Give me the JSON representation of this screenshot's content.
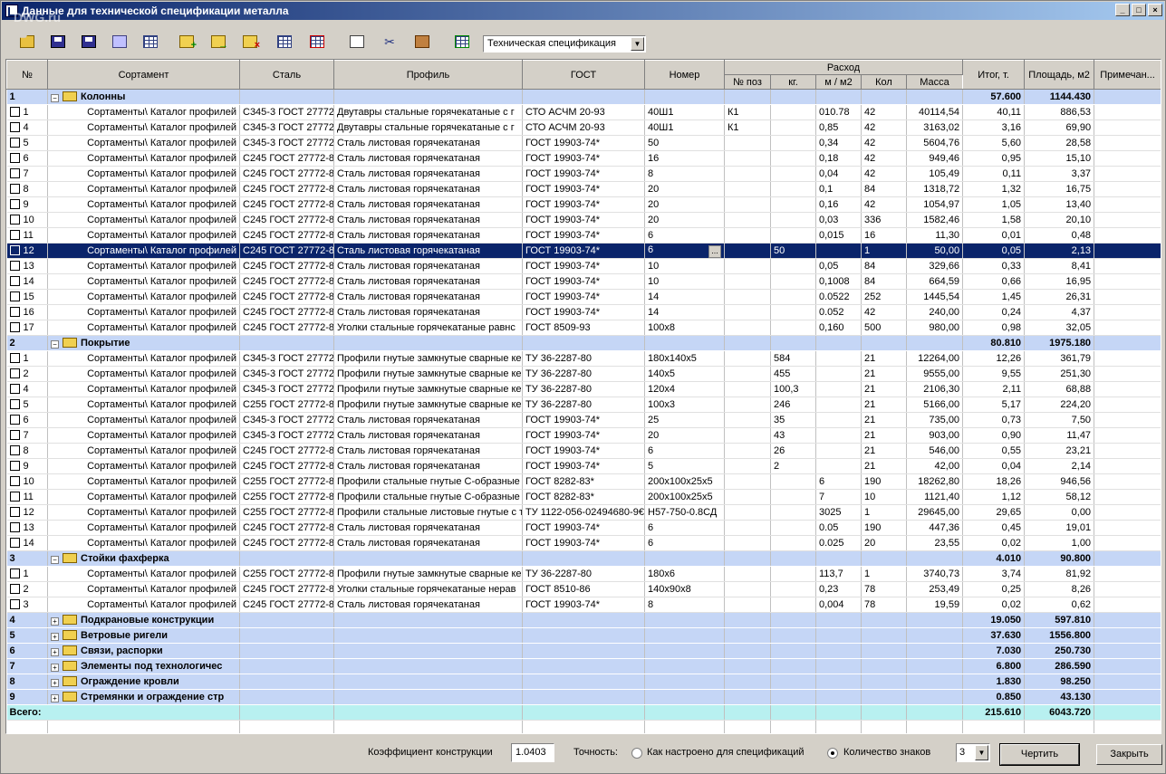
{
  "window": {
    "title": "Данные для технической спецификации металла",
    "watermark": "DWG.ru",
    "min_glyph": "_",
    "max_glyph": "□",
    "close_glyph": "×"
  },
  "toolbar": {
    "icons": [
      "open-icon",
      "save-icon",
      "save-as-icon",
      "properties-icon",
      "table-edit-icon",
      "add-folder-icon",
      "add-subfolder-icon",
      "delete-folder-icon",
      "add-row-icon",
      "delete-row-icon",
      "copy-icon",
      "cut-icon",
      "paste-icon",
      "settings-icon"
    ],
    "spec_type": "Техническая спецификация"
  },
  "columns": {
    "num": "№",
    "sortament": "Сортамент",
    "steel": "Сталь",
    "profile": "Профиль",
    "gost": "ГОСТ",
    "nomer": "Номер",
    "rashod": "Расход",
    "poz": "№ поз",
    "kg": "кг.",
    "m": "м / м2",
    "kol": "Кол",
    "massa": "Масса",
    "itog": "Итог, т.",
    "area": "Площадь, м2",
    "note": "Примечан..."
  },
  "groups": [
    {
      "num": "1",
      "name": "Колонны",
      "itog": "57.600",
      "area": "1144.430",
      "expanded": true,
      "rows": [
        {
          "n": "1",
          "s": "Сортаменты\\ Каталог профилей",
          "st": "С345-3 ГОСТ 27772",
          "p": "Двутавры стальные горячекатаные с г",
          "g": "СТО АСЧМ 20-93",
          "nm": "40Ш1",
          "poz": "К1",
          "kg": "",
          "m": "010.78",
          "kol": "42",
          "ms": "40114,54",
          "it": "40,11",
          "ar": "886,53"
        },
        {
          "n": "4",
          "s": "Сортаменты\\ Каталог профилей",
          "st": "С345-3 ГОСТ 27772",
          "p": "Двутавры стальные горячекатаные с г",
          "g": "СТО АСЧМ 20-93",
          "nm": "40Ш1",
          "poz": "К1",
          "kg": "",
          "m": "0,85",
          "kol": "42",
          "ms": "3163,02",
          "it": "3,16",
          "ar": "69,90"
        },
        {
          "n": "5",
          "s": "Сортаменты\\ Каталог профилей",
          "st": "С345-3 ГОСТ 27772",
          "p": "Сталь листовая горячекатаная",
          "g": "ГОСТ 19903-74*",
          "nm": "50",
          "poz": "",
          "kg": "",
          "m": "0,34",
          "kol": "42",
          "ms": "5604,76",
          "it": "5,60",
          "ar": "28,58"
        },
        {
          "n": "6",
          "s": "Сортаменты\\ Каталог профилей",
          "st": "С245 ГОСТ 27772-8",
          "p": "Сталь листовая горячекатаная",
          "g": "ГОСТ 19903-74*",
          "nm": "16",
          "poz": "",
          "kg": "",
          "m": "0,18",
          "kol": "42",
          "ms": "949,46",
          "it": "0,95",
          "ar": "15,10"
        },
        {
          "n": "7",
          "s": "Сортаменты\\ Каталог профилей",
          "st": "С245 ГОСТ 27772-8",
          "p": "Сталь листовая горячекатаная",
          "g": "ГОСТ 19903-74*",
          "nm": "8",
          "poz": "",
          "kg": "",
          "m": "0,04",
          "kol": "42",
          "ms": "105,49",
          "it": "0,11",
          "ar": "3,37"
        },
        {
          "n": "8",
          "s": "Сортаменты\\ Каталог профилей",
          "st": "С245 ГОСТ 27772-8",
          "p": "Сталь листовая горячекатаная",
          "g": "ГОСТ 19903-74*",
          "nm": "20",
          "poz": "",
          "kg": "",
          "m": "0,1",
          "kol": "84",
          "ms": "1318,72",
          "it": "1,32",
          "ar": "16,75"
        },
        {
          "n": "9",
          "s": "Сортаменты\\ Каталог профилей",
          "st": "С245 ГОСТ 27772-8",
          "p": "Сталь листовая горячекатаная",
          "g": "ГОСТ 19903-74*",
          "nm": "20",
          "poz": "",
          "kg": "",
          "m": "0,16",
          "kol": "42",
          "ms": "1054,97",
          "it": "1,05",
          "ar": "13,40"
        },
        {
          "n": "10",
          "s": "Сортаменты\\ Каталог профилей",
          "st": "С245 ГОСТ 27772-8",
          "p": "Сталь листовая горячекатаная",
          "g": "ГОСТ 19903-74*",
          "nm": "20",
          "poz": "",
          "kg": "",
          "m": "0,03",
          "kol": "336",
          "ms": "1582,46",
          "it": "1,58",
          "ar": "20,10"
        },
        {
          "n": "11",
          "s": "Сортаменты\\ Каталог профилей",
          "st": "С245 ГОСТ 27772-8",
          "p": "Сталь листовая горячекатаная",
          "g": "ГОСТ 19903-74*",
          "nm": "6",
          "poz": "",
          "kg": "",
          "m": "0,015",
          "kol": "16",
          "ms": "11,30",
          "it": "0,01",
          "ar": "0,48"
        },
        {
          "n": "12",
          "s": "Сортаменты\\ Каталог профилей",
          "st": "С245 ГОСТ 27772-8",
          "p": "Сталь листовая горячекатаная",
          "g": "ГОСТ 19903-74*",
          "nm": "6",
          "poz": "",
          "kg": "50",
          "m": "",
          "kol": "1",
          "ms": "50,00",
          "it": "0,05",
          "ar": "2,13",
          "selected": true
        },
        {
          "n": "13",
          "s": "Сортаменты\\ Каталог профилей",
          "st": "С245 ГОСТ 27772-8",
          "p": "Сталь листовая горячекатаная",
          "g": "ГОСТ 19903-74*",
          "nm": "10",
          "poz": "",
          "kg": "",
          "m": "0,05",
          "kol": "84",
          "ms": "329,66",
          "it": "0,33",
          "ar": "8,41"
        },
        {
          "n": "14",
          "s": "Сортаменты\\ Каталог профилей",
          "st": "С245 ГОСТ 27772-8",
          "p": "Сталь листовая горячекатаная",
          "g": "ГОСТ 19903-74*",
          "nm": "10",
          "poz": "",
          "kg": "",
          "m": "0,1008",
          "kol": "84",
          "ms": "664,59",
          "it": "0,66",
          "ar": "16,95"
        },
        {
          "n": "15",
          "s": "Сортаменты\\ Каталог профилей",
          "st": "С245 ГОСТ 27772-8",
          "p": "Сталь листовая горячекатаная",
          "g": "ГОСТ 19903-74*",
          "nm": "14",
          "poz": "",
          "kg": "",
          "m": "0.0522",
          "kol": "252",
          "ms": "1445,54",
          "it": "1,45",
          "ar": "26,31"
        },
        {
          "n": "16",
          "s": "Сортаменты\\ Каталог профилей",
          "st": "С245 ГОСТ 27772-8",
          "p": "Сталь листовая горячекатаная",
          "g": "ГОСТ 19903-74*",
          "nm": "14",
          "poz": "",
          "kg": "",
          "m": "0.052",
          "kol": "42",
          "ms": "240,00",
          "it": "0,24",
          "ar": "4,37"
        },
        {
          "n": "17",
          "s": "Сортаменты\\ Каталог профилей",
          "st": "С245 ГОСТ 27772-8",
          "p": "Уголки стальные горячекатаные равнс",
          "g": "ГОСТ 8509-93",
          "nm": "100x8",
          "poz": "",
          "kg": "",
          "m": "0,160",
          "kol": "500",
          "ms": "980,00",
          "it": "0,98",
          "ar": "32,05"
        }
      ]
    },
    {
      "num": "2",
      "name": "Покрытие",
      "itog": "80.810",
      "area": "1975.180",
      "expanded": true,
      "rows": [
        {
          "n": "1",
          "s": "Сортаменты\\ Каталог профилей",
          "st": "С345-3 ГОСТ 27772",
          "p": "Профили гнутые замкнутые сварные ке",
          "g": "ТУ 36-2287-80",
          "nm": "180x140x5",
          "poz": "",
          "kg": "584",
          "m": "",
          "kol": "21",
          "ms": "12264,00",
          "it": "12,26",
          "ar": "361,79"
        },
        {
          "n": "2",
          "s": "Сортаменты\\ Каталог профилей",
          "st": "С345-3 ГОСТ 27772",
          "p": "Профили гнутые замкнутые сварные ке",
          "g": "ТУ 36-2287-80",
          "nm": "140x5",
          "poz": "",
          "kg": "455",
          "m": "",
          "kol": "21",
          "ms": "9555,00",
          "it": "9,55",
          "ar": "251,30"
        },
        {
          "n": "4",
          "s": "Сортаменты\\ Каталог профилей",
          "st": "С345-3 ГОСТ 27772",
          "p": "Профили гнутые замкнутые сварные ке",
          "g": "ТУ 36-2287-80",
          "nm": "120x4",
          "poz": "",
          "kg": "100,3",
          "m": "",
          "kol": "21",
          "ms": "2106,30",
          "it": "2,11",
          "ar": "68,88"
        },
        {
          "n": "5",
          "s": "Сортаменты\\ Каталог профилей",
          "st": "С255 ГОСТ 27772-8",
          "p": "Профили гнутые замкнутые сварные ке",
          "g": "ТУ 36-2287-80",
          "nm": "100x3",
          "poz": "",
          "kg": "246",
          "m": "",
          "kol": "21",
          "ms": "5166,00",
          "it": "5,17",
          "ar": "224,20"
        },
        {
          "n": "6",
          "s": "Сортаменты\\ Каталог профилей",
          "st": "С345-3 ГОСТ 27772",
          "p": "Сталь листовая горячекатаная",
          "g": "ГОСТ 19903-74*",
          "nm": "25",
          "poz": "",
          "kg": "35",
          "m": "",
          "kol": "21",
          "ms": "735,00",
          "it": "0,73",
          "ar": "7,50"
        },
        {
          "n": "7",
          "s": "Сортаменты\\ Каталог профилей",
          "st": "С345-3 ГОСТ 27772",
          "p": "Сталь листовая горячекатаная",
          "g": "ГОСТ 19903-74*",
          "nm": "20",
          "poz": "",
          "kg": "43",
          "m": "",
          "kol": "21",
          "ms": "903,00",
          "it": "0,90",
          "ar": "11,47"
        },
        {
          "n": "8",
          "s": "Сортаменты\\ Каталог профилей",
          "st": "С245 ГОСТ 27772-8",
          "p": "Сталь листовая горячекатаная",
          "g": "ГОСТ 19903-74*",
          "nm": "6",
          "poz": "",
          "kg": "26",
          "m": "",
          "kol": "21",
          "ms": "546,00",
          "it": "0,55",
          "ar": "23,21"
        },
        {
          "n": "9",
          "s": "Сортаменты\\ Каталог профилей",
          "st": "С245 ГОСТ 27772-8",
          "p": "Сталь листовая горячекатаная",
          "g": "ГОСТ 19903-74*",
          "nm": "5",
          "poz": "",
          "kg": "2",
          "m": "",
          "kol": "21",
          "ms": "42,00",
          "it": "0,04",
          "ar": "2,14"
        },
        {
          "n": "10",
          "s": "Сортаменты\\ Каталог профилей",
          "st": "С255 ГОСТ 27772-8",
          "p": "Профили стальные гнутые С-образные",
          "g": "ГОСТ 8282-83*",
          "nm": "200x100x25x5",
          "poz": "",
          "kg": "",
          "m": "6",
          "kol": "190",
          "ms": "18262,80",
          "it": "18,26",
          "ar": "946,56"
        },
        {
          "n": "11",
          "s": "Сортаменты\\ Каталог профилей",
          "st": "С255 ГОСТ 27772-8",
          "p": "Профили стальные гнутые С-образные",
          "g": "ГОСТ 8282-83*",
          "nm": "200x100x25x5",
          "poz": "",
          "kg": "",
          "m": "7",
          "kol": "10",
          "ms": "1121,40",
          "it": "1,12",
          "ar": "58,12"
        },
        {
          "n": "12",
          "s": "Сортаменты\\ Каталог профилей",
          "st": "С255 ГОСТ 27772-8",
          "p": "Профили стальные листовые гнутые с т",
          "g": "ТУ 1122-056-02494680-9€",
          "nm": "Н57-750-0.8СД",
          "poz": "",
          "kg": "",
          "m": "3025",
          "kol": "1",
          "ms": "29645,00",
          "it": "29,65",
          "ar": "0,00"
        },
        {
          "n": "13",
          "s": "Сортаменты\\ Каталог профилей",
          "st": "С245 ГОСТ 27772-8",
          "p": "Сталь листовая горячекатаная",
          "g": "ГОСТ 19903-74*",
          "nm": "6",
          "poz": "",
          "kg": "",
          "m": "0.05",
          "kol": "190",
          "ms": "447,36",
          "it": "0,45",
          "ar": "19,01"
        },
        {
          "n": "14",
          "s": "Сортаменты\\ Каталог профилей",
          "st": "С245 ГОСТ 27772-8",
          "p": "Сталь листовая горячекатаная",
          "g": "ГОСТ 19903-74*",
          "nm": "6",
          "poz": "",
          "kg": "",
          "m": "0.025",
          "kol": "20",
          "ms": "23,55",
          "it": "0,02",
          "ar": "1,00"
        }
      ]
    },
    {
      "num": "3",
      "name": "Стойки фахферка",
      "itog": "4.010",
      "area": "90.800",
      "expanded": true,
      "rows": [
        {
          "n": "1",
          "s": "Сортаменты\\ Каталог профилей",
          "st": "С255 ГОСТ 27772-8",
          "p": "Профили гнутые замкнутые сварные ке",
          "g": "ТУ 36-2287-80",
          "nm": "180x6",
          "poz": "",
          "kg": "",
          "m": "113,7",
          "kol": "1",
          "ms": "3740,73",
          "it": "3,74",
          "ar": "81,92"
        },
        {
          "n": "2",
          "s": "Сортаменты\\ Каталог профилей",
          "st": "С245 ГОСТ 27772-8",
          "p": "Уголки стальные горячекатаные нерав",
          "g": "ГОСТ 8510-86",
          "nm": "140x90x8",
          "poz": "",
          "kg": "",
          "m": "0,23",
          "kol": "78",
          "ms": "253,49",
          "it": "0,25",
          "ar": "8,26"
        },
        {
          "n": "3",
          "s": "Сортаменты\\ Каталог профилей",
          "st": "С245 ГОСТ 27772-8",
          "p": "Сталь листовая горячекатаная",
          "g": "ГОСТ 19903-74*",
          "nm": "8",
          "poz": "",
          "kg": "",
          "m": "0,004",
          "kol": "78",
          "ms": "19,59",
          "it": "0,02",
          "ar": "0,62"
        }
      ]
    },
    {
      "num": "4",
      "name": "Подкрановые конструкции",
      "itog": "19.050",
      "area": "597.810",
      "expanded": false,
      "rows": []
    },
    {
      "num": "5",
      "name": "Ветровые ригели",
      "itog": "37.630",
      "area": "1556.800",
      "expanded": false,
      "rows": []
    },
    {
      "num": "6",
      "name": "Связи, распорки",
      "itog": "7.030",
      "area": "250.730",
      "expanded": false,
      "rows": []
    },
    {
      "num": "7",
      "name": "Элементы под технологичес",
      "itog": "6.800",
      "area": "286.590",
      "expanded": false,
      "rows": []
    },
    {
      "num": "8",
      "name": "Ограждение кровли",
      "itog": "1.830",
      "area": "98.250",
      "expanded": false,
      "rows": []
    },
    {
      "num": "9",
      "name": "Стремянки и ограждение стр",
      "itog": "0.850",
      "area": "43.130",
      "expanded": false,
      "rows": []
    }
  ],
  "total": {
    "label": "Всего:",
    "itog": "215.610",
    "area": "6043.720"
  },
  "bottom": {
    "coef_label": "Коэффициент конструкции",
    "coef_value": "1.0403",
    "precision_label": "Точность:",
    "radio1_label": "Как настроено для спецификаций",
    "radio2_label": "Количество знаков",
    "digits_value": "3",
    "draw_button": "Чертить",
    "close_button": "Закрыть"
  },
  "colors": {
    "group_bg": "#c5d6f6",
    "selected_bg": "#0a246a",
    "total_bg": "#b8f0f0"
  }
}
